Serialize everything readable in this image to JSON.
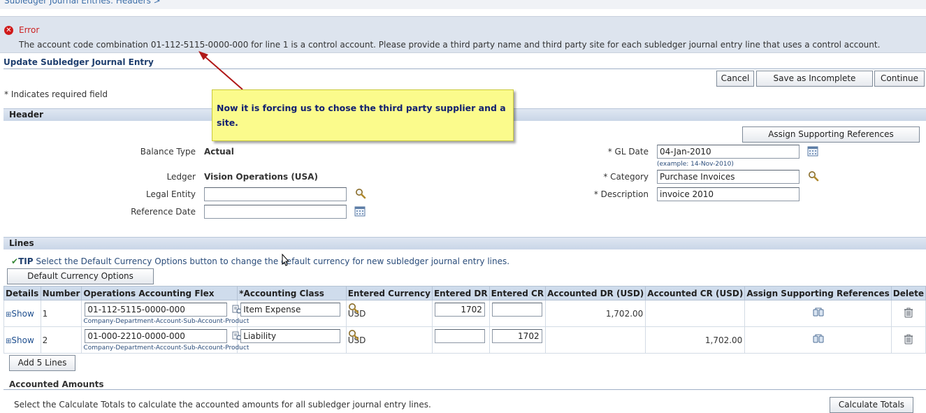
{
  "breadcrumb": "Subledger Journal Entries: Headers  >",
  "error": {
    "title": "Error",
    "message": "The account code combination 01-112-5115-0000-000 for line 1 is a control account. Please provide a third party name and third party site for each subledger journal entry line that uses a control account."
  },
  "page_title": "Update Subledger Journal Entry",
  "actions": {
    "cancel": "Cancel",
    "save_incomplete": "Save as Incomplete",
    "continue": "Continue"
  },
  "required_note": "* Indicates required field",
  "callout": "Now it is forcing us to chose the third party supplier and a site.",
  "header": {
    "section_title": "Header",
    "assign_refs": "Assign Supporting References",
    "balance_type_label": "Balance Type",
    "balance_type_value": "Actual",
    "ledger_label": "Ledger",
    "ledger_value": "Vision Operations (USA)",
    "legal_entity_label": "Legal Entity",
    "legal_entity_value": "",
    "reference_date_label": "Reference Date",
    "reference_date_value": "",
    "gl_date_label": "* GL Date",
    "gl_date_value": "04-Jan-2010",
    "gl_date_hint": "(example: 14-Nov-2010)",
    "category_label": "* Category",
    "category_value": "Purchase Invoices",
    "description_label": "* Description",
    "description_value": "invoice 2010"
  },
  "lines": {
    "section_title": "Lines",
    "tip_label": "TIP",
    "tip_text": " Select the Default Currency Options button to change the default currency for new subledger journal entry lines.",
    "default_currency_button": "Default Currency Options",
    "columns": [
      "Details",
      "Number",
      "Operations Accounting Flex",
      "*Accounting Class",
      "Entered Currency",
      "Entered DR",
      "Entered CR",
      "Accounted DR (USD)",
      "Accounted CR (USD)",
      "Assign Supporting References",
      "Delete"
    ],
    "rows": [
      {
        "details": "Show",
        "number": "1",
        "flex": "01-112-5115-0000-000",
        "flex_hint": "Company-Department-Account-Sub-Account-Product",
        "acct_class": "Item Expense",
        "currency": "USD",
        "entered_dr": "1702",
        "entered_cr": "",
        "accounted_dr": "1,702.00",
        "accounted_cr": ""
      },
      {
        "details": "Show",
        "number": "2",
        "flex": "01-000-2210-0000-000",
        "flex_hint": "Company-Department-Account-Sub-Account-Product",
        "acct_class": "Liability",
        "currency": "USD",
        "entered_dr": "",
        "entered_cr": "1702",
        "accounted_dr": "",
        "accounted_cr": "1,702.00"
      }
    ],
    "add_lines_button": "Add 5 Lines"
  },
  "accounted": {
    "title": "Accounted Amounts",
    "message": "Select the Calculate Totals to calculate the accounted amounts for all subledger journal entry lines.",
    "calculate_button": "Calculate Totals"
  }
}
